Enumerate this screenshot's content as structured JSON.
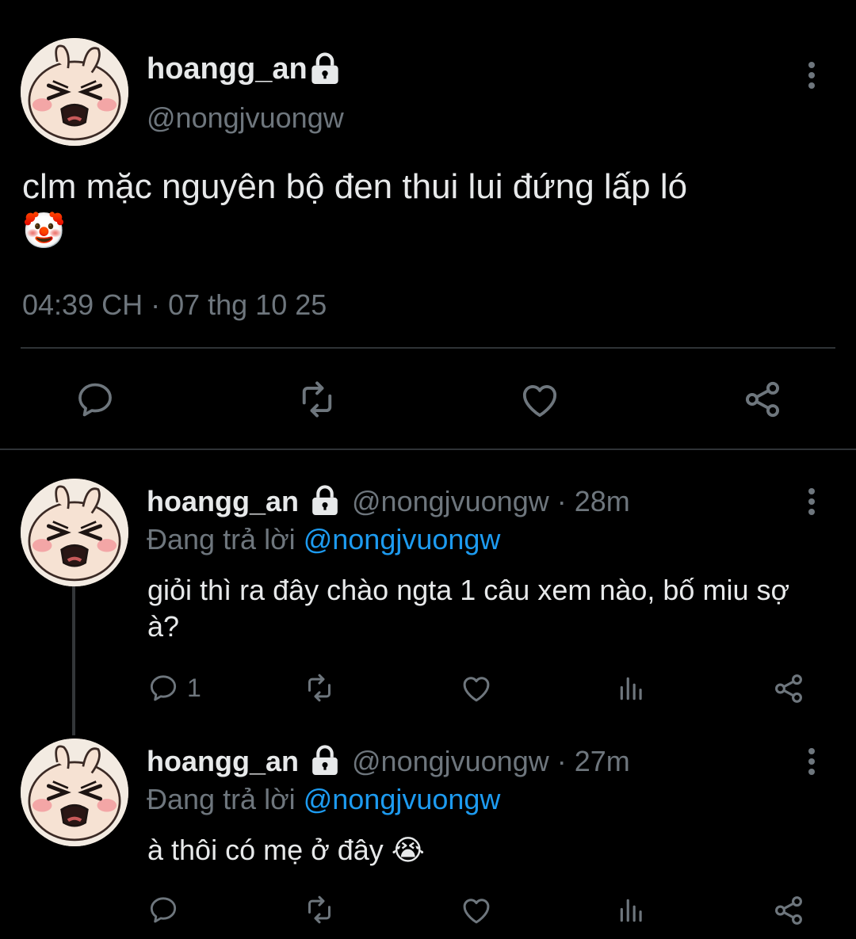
{
  "colors": {
    "background": "#000000",
    "text": "#e7e9ea",
    "muted": "#6e767d",
    "link": "#1d9bf0",
    "divider": "#2f3336"
  },
  "main_tweet": {
    "display_name": "hoangg_an",
    "handle": "@nongjvuongw",
    "locked_icon": "lock-icon",
    "text": "clm mặc nguyên bộ đen thui lui đứng lấp ló",
    "emoji": "🤡",
    "timestamp": "04:39 CH · 07 thg 10 25",
    "actions": [
      "reply-icon",
      "retweet-icon",
      "like-icon",
      "share-icon"
    ]
  },
  "replies": [
    {
      "display_name": "hoangg_an",
      "handle": "@nongjvuongw",
      "time": "· 28m",
      "replying_prefix": "Đang trả lời",
      "replying_to": "@nongjvuongw",
      "text": "giỏi thì ra đây chào ngta 1 câu xem nào, bố miu sợ à?",
      "reply_count": "1",
      "actions": [
        "reply-icon",
        "retweet-icon",
        "like-icon",
        "views-icon",
        "share-icon"
      ]
    },
    {
      "display_name": "hoangg_an",
      "handle": "@nongjvuongw",
      "time": "· 27m",
      "replying_prefix": "Đang trả lời",
      "replying_to": "@nongjvuongw",
      "text": "à thôi có mẹ ở đây",
      "emoji": "😭",
      "reply_count": "",
      "actions": [
        "reply-icon",
        "retweet-icon",
        "like-icon",
        "views-icon",
        "share-icon"
      ]
    }
  ]
}
